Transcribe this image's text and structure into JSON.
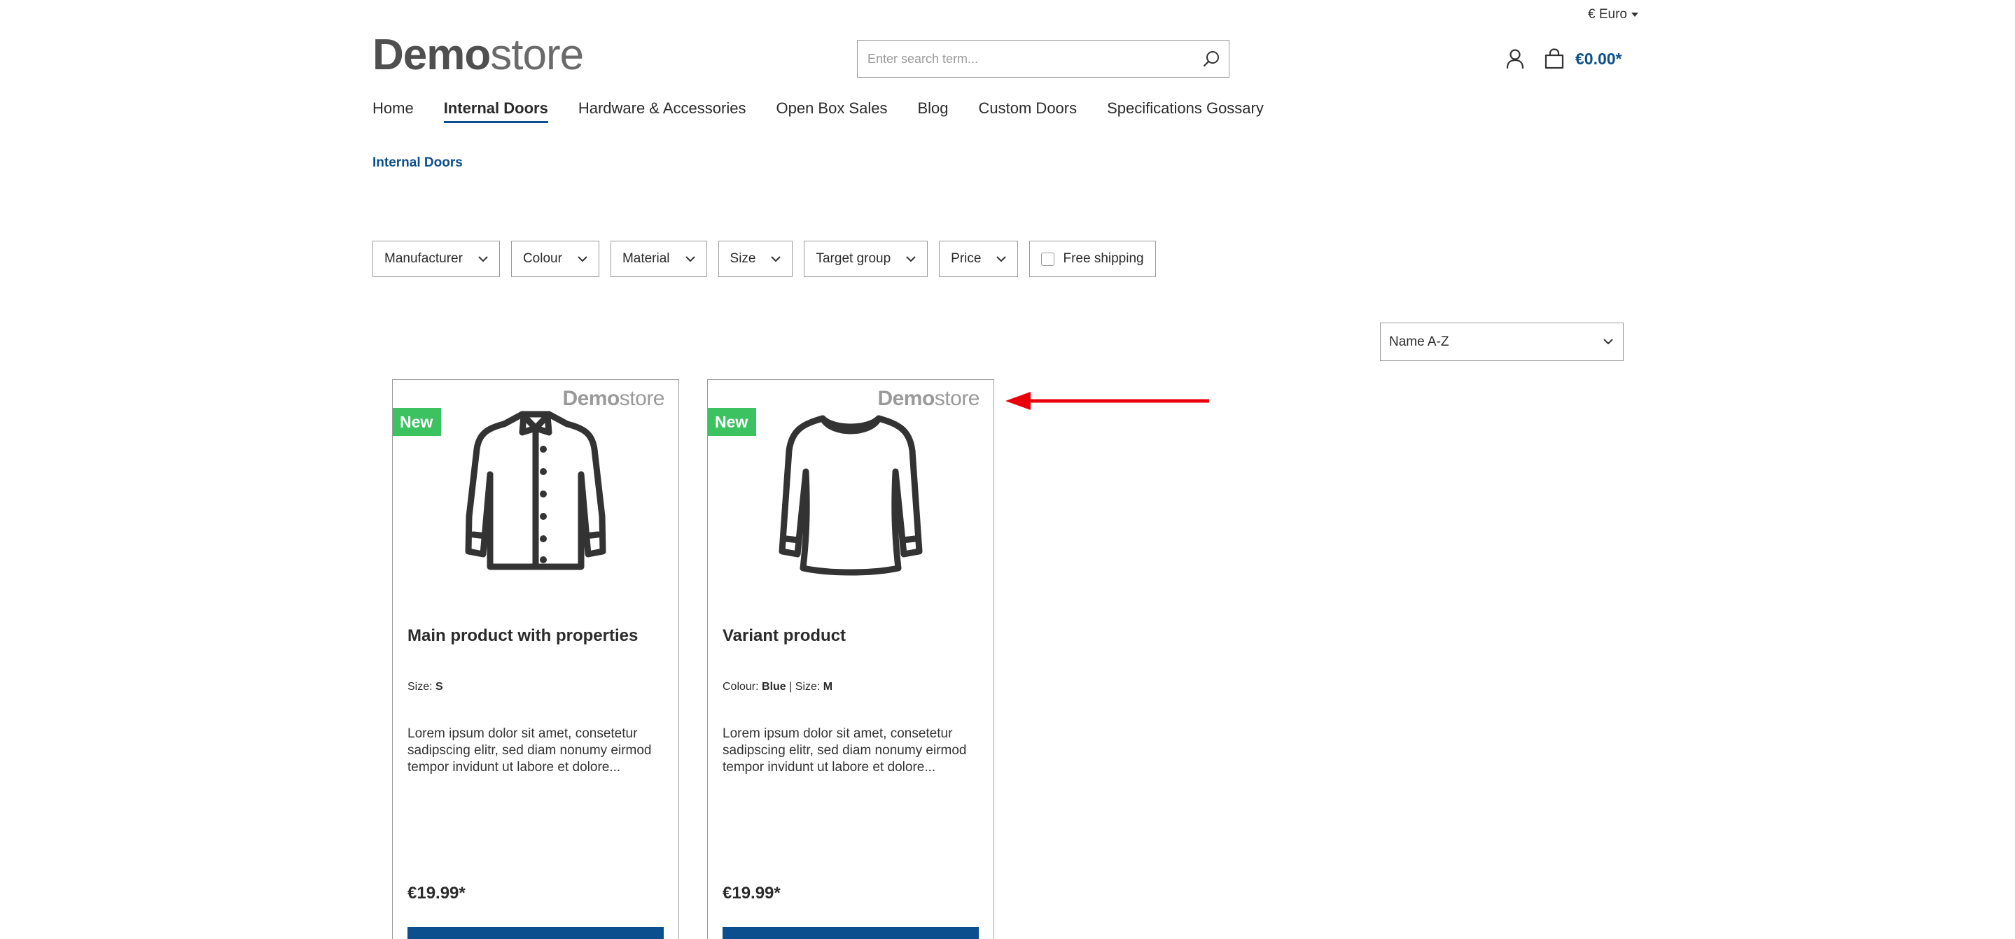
{
  "header": {
    "currency_label": "€ Euro",
    "logo_bold": "Demo",
    "logo_light": "store",
    "search_placeholder": "Enter search term...",
    "cart_total": "€0.00*"
  },
  "nav": {
    "items": [
      {
        "label": "Home",
        "active": false
      },
      {
        "label": "Internal Doors",
        "active": true
      },
      {
        "label": "Hardware & Accessories",
        "active": false
      },
      {
        "label": "Open Box Sales",
        "active": false
      },
      {
        "label": "Blog",
        "active": false
      },
      {
        "label": "Custom Doors",
        "active": false
      },
      {
        "label": "Specifications Gossary",
        "active": false
      }
    ]
  },
  "breadcrumb": {
    "current": "Internal Doors"
  },
  "filters": {
    "items": [
      "Manufacturer",
      "Colour",
      "Material",
      "Size",
      "Target group",
      "Price"
    ],
    "free_shipping_label": "Free shipping",
    "free_shipping_checked": false
  },
  "sort": {
    "selected": "Name A-Z"
  },
  "products": [
    {
      "badge": "New",
      "watermark_bold": "Demo",
      "watermark_light": "store",
      "image_icon": "shirt-icon",
      "title": "Main product with properties",
      "props": [
        {
          "label": "Size:",
          "value": "S"
        }
      ],
      "description": "Lorem ipsum dolor sit amet, consetetur sadipscing elitr, sed diam nonumy eirmod tempor invidunt ut labore et dolore...",
      "price": "€19.99*"
    },
    {
      "badge": "New",
      "watermark_bold": "Demo",
      "watermark_light": "store",
      "image_icon": "sweater-icon",
      "title": "Variant product",
      "props": [
        {
          "label": "Colour:",
          "value": "Blue"
        },
        {
          "label": "Size:",
          "value": "M"
        }
      ],
      "description": "Lorem ipsum dolor sit amet, consetetur sadipscing elitr, sed diam nonumy eirmod tempor invidunt ut labore et dolore...",
      "price": "€19.99*"
    }
  ],
  "colors": {
    "accent": "#0b4f8e",
    "badge_green": "#3cc261",
    "annotation_red": "#e8000b"
  }
}
